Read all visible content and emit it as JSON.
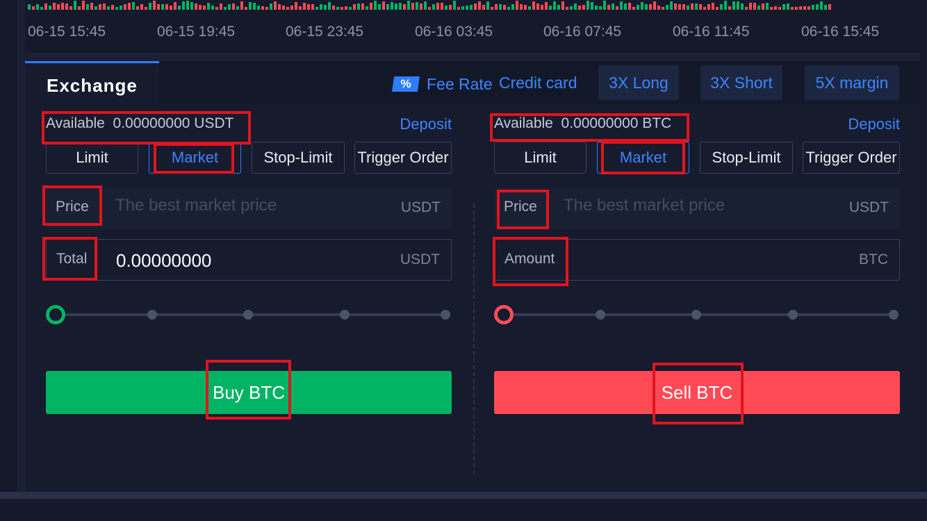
{
  "chart": {
    "time_labels": [
      "06-15 15:45",
      "06-15 19:45",
      "06-15 23:45",
      "06-16 03:45",
      "06-16 07:45",
      "06-16 11:45",
      "06-16 15:45"
    ]
  },
  "tabs": {
    "exchange": "Exchange",
    "fee_badge": "%",
    "fee_rate": "Fee Rate",
    "credit_card": "Credit card",
    "long_3x": "3X Long",
    "short_3x": "3X Short",
    "margin_5x": "5X margin"
  },
  "buy": {
    "available": "Available  0.00000000 USDT",
    "deposit": "Deposit",
    "order_types": [
      "Limit",
      "Market",
      "Stop-Limit",
      "Trigger Order"
    ],
    "selected_order_type": "Market",
    "price_label": "Price",
    "price_placeholder": "The best market price",
    "price_unit": "USDT",
    "total_label": "Total",
    "total_value": "0.00000000",
    "total_unit": "USDT",
    "slider_percent": 0,
    "action": "Buy BTC"
  },
  "sell": {
    "available": "Available  0.00000000 BTC",
    "deposit": "Deposit",
    "order_types": [
      "Limit",
      "Market",
      "Stop-Limit",
      "Trigger Order"
    ],
    "selected_order_type": "Market",
    "price_label": "Price",
    "price_placeholder": "The best market price",
    "price_unit": "USDT",
    "amount_label": "Amount",
    "amount_value": "",
    "amount_unit": "BTC",
    "slider_percent": 0,
    "action": "Sell BTC"
  },
  "colors": {
    "accent": "#2f7dff",
    "buy": "#00b464",
    "sell": "#ff4a55",
    "highlight": "#e0141f"
  }
}
